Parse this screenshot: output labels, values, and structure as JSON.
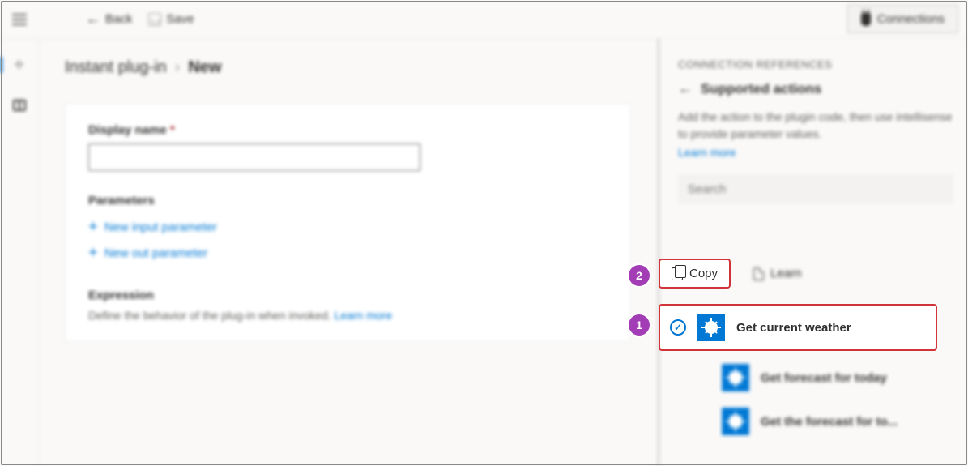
{
  "topbar": {
    "back": "Back",
    "save": "Save",
    "connections": "Connections"
  },
  "breadcrumb": {
    "parent": "Instant plug-in",
    "current": "New"
  },
  "form": {
    "display_name_label": "Display name",
    "display_name_value": "",
    "parameters_heading": "Parameters",
    "new_input": "New input parameter",
    "new_out": "New out parameter",
    "expression_heading": "Expression",
    "expression_desc": "Define the behavior of the plug-in when invoked.",
    "expression_learn": "Learn more"
  },
  "sidepanel": {
    "eyebrow": "CONNECTION REFERENCES",
    "title": "Supported actions",
    "help": "Add the action to the plugin code, then use intellisense to provide parameter values.",
    "learn": "Learn more",
    "search_placeholder": "Search",
    "copy": "Copy",
    "learn_btn": "Learn",
    "actions": [
      {
        "label": "Get current weather",
        "selected": true
      },
      {
        "label": "Get forecast for today",
        "selected": false
      },
      {
        "label": "Get the forecast for to...",
        "selected": false
      }
    ]
  },
  "callouts": {
    "one": "1",
    "two": "2"
  }
}
